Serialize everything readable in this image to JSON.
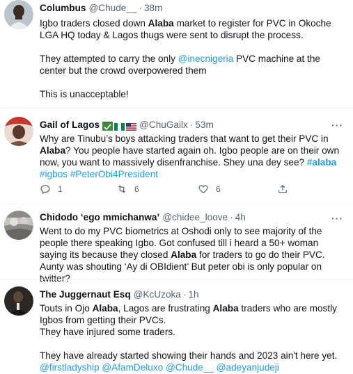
{
  "tweets": [
    {
      "name": "Columbus",
      "handle": "@Chude__",
      "time": "38m",
      "body": [
        [
          {
            "t": "Igbo traders closed down "
          },
          {
            "t": "Alaba",
            "b": true
          },
          {
            "t": " market to register for PVC in Okoche LGA HQ today & Lagos thugs were sent to disrupt the process."
          }
        ],
        [],
        [
          {
            "t": "They attempted to carry the only "
          },
          {
            "t": "@inecnigeria",
            "l": true
          },
          {
            "t": " PVC machine at the center but the crowd overpowered them"
          }
        ],
        [],
        [
          {
            "t": "This is unacceptable!"
          }
        ]
      ]
    },
    {
      "name": "Gail of Lagos",
      "handle": "@ChuGailx",
      "time": "53m",
      "flags": [
        "vote-box-emoji",
        "nigeria-flag",
        "usa-flag"
      ],
      "body": [
        [
          {
            "t": "Why are Tinubu’s boys attacking traders that want to get their PVC in "
          },
          {
            "t": "Alaba",
            "b": true
          },
          {
            "t": "? You people have started again oh. Igbo people are on their own now, you want to massively disenfranchise. Shey una dey see? "
          },
          {
            "t": "#alaba",
            "l": true,
            "b": true
          },
          {
            "t": " "
          },
          {
            "t": "#igbos",
            "l": true
          },
          {
            "t": " "
          },
          {
            "t": "#PeterObi4President",
            "l": true
          }
        ]
      ],
      "actions": {
        "replies": "1",
        "retweets": "6",
        "likes": "6"
      }
    },
    {
      "name": "Chidodo ‘ego mmichanwa’",
      "handle": "@chidee_loove",
      "time": "4h",
      "body": [
        [
          {
            "t": "Went to do my PVC biometrics at Oshodi only to see majority of the people there speaking Igbo. Got confused till i heard a 50+ woman saying its because they closed "
          },
          {
            "t": "Alaba",
            "b": true
          },
          {
            "t": " for traders to go do their PVC. Aunty was shouting ‘Ay di OBIdient’ But peter obi is only popular on twitter?"
          }
        ]
      ]
    },
    {
      "name": "The Juggernaut Esq",
      "handle": "@KcUzoka",
      "time": "1h",
      "body": [
        [
          {
            "t": "Touts in Ojo "
          },
          {
            "t": "Alaba",
            "b": true
          },
          {
            "t": ", Lagos are frustrating "
          },
          {
            "t": "Alaba",
            "b": true
          },
          {
            "t": " traders who are mostly Igbos from getting their PVCs."
          }
        ],
        [
          {
            "t": "They have injured some traders."
          }
        ],
        [],
        [
          {
            "t": "They have already started showing their hands and 2023 ain't here yet."
          }
        ],
        [
          {
            "t": "@firstladyship",
            "l": true
          },
          {
            "t": " "
          },
          {
            "t": "@AfamDeluxo",
            "l": true
          },
          {
            "t": " "
          },
          {
            "t": "@Chude__",
            "l": true
          },
          {
            "t": " "
          },
          {
            "t": "@adeyanjudeji",
            "l": true
          }
        ]
      ]
    }
  ],
  "colors": {
    "link": "#1d9bf0",
    "secondary": "#536471",
    "text": "#0f1419"
  },
  "separator": "·",
  "more_icon": "···"
}
